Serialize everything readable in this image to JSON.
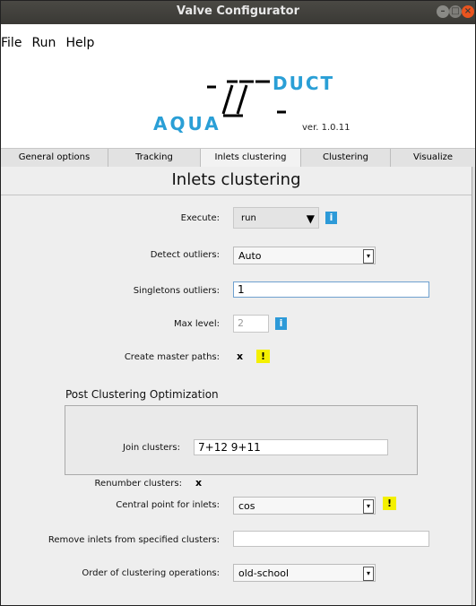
{
  "window": {
    "title": "Valve Configurator"
  },
  "menu": [
    "File",
    "Run",
    "Help"
  ],
  "logo": {
    "left_text": "AQUA",
    "right_text": "DUCT",
    "version": "ver. 1.0.11"
  },
  "tabs": [
    "General options",
    "Tracking",
    "Inlets clustering",
    "Clustering",
    "Visualize"
  ],
  "active_tab": "Inlets clustering",
  "page": {
    "title": "Inlets clustering"
  },
  "fields": {
    "execute": {
      "label": "Execute:",
      "value": "run"
    },
    "detect_outliers": {
      "label": "Detect outliers:",
      "value": "Auto"
    },
    "singletons_outliers": {
      "label": "Singletons outliers:",
      "value": "1"
    },
    "max_level": {
      "label": "Max level:",
      "value": "2"
    },
    "create_master_paths": {
      "label": "Create master paths:",
      "checked": "x"
    },
    "post_optimization": {
      "title": "Post Clustering Optimization",
      "join_clusters": {
        "label": "Join clusters:",
        "value": "7+12 9+11"
      },
      "renumber_clusters": {
        "label": "Renumber clusters:",
        "checked": "x"
      }
    },
    "central_point": {
      "label": "Central point for inlets:",
      "value": "cos"
    },
    "remove_inlets": {
      "label": "Remove inlets from specified clusters:",
      "value": ""
    },
    "order_ops": {
      "label": "Order of clustering operations:",
      "value": "old-school"
    }
  },
  "glyphs": {
    "info": "i",
    "warn": "!",
    "dropdown": "▼",
    "combo_arrow": "▾"
  },
  "colors": {
    "info": "#2d9ad8",
    "warn": "#f4f000",
    "logo_accent": "#2a9fd6",
    "close": "#e9541f"
  }
}
